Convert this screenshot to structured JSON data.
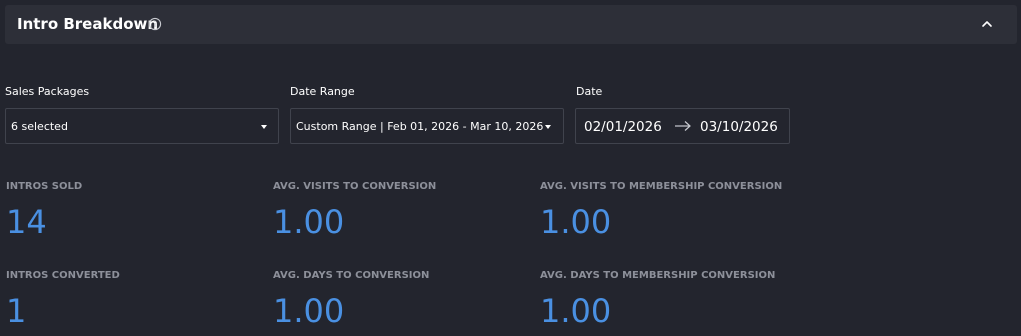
{
  "panel": {
    "title": "Intro Breakdown",
    "info_icon": "info-circle-icon",
    "collapse_icon": "chevron-up-icon"
  },
  "filters": {
    "sales_packages": {
      "label": "Sales Packages",
      "value": "6 selected"
    },
    "date_range": {
      "label": "Date Range",
      "value": "Custom Range | Feb 01, 2026 - Mar 10, 2026"
    },
    "date": {
      "label": "Date",
      "start": "02/01/2026",
      "end": "03/10/2026",
      "arrow_icon": "arrow-right-icon"
    }
  },
  "metrics": {
    "intros_sold": {
      "label": "INTROS SOLD",
      "value": "14"
    },
    "avg_visits_to_conversion": {
      "label": "AVG. VISITS TO CONVERSION",
      "value": "1.00"
    },
    "avg_visits_to_membership_conversion": {
      "label": "AVG. VISITS TO MEMBERSHIP CONVERSION",
      "value": "1.00"
    },
    "intros_converted": {
      "label": "INTROS CONVERTED",
      "value": "1"
    },
    "avg_days_to_conversion": {
      "label": "AVG. DAYS TO CONVERSION",
      "value": "1.00"
    },
    "avg_days_to_membership_conversion": {
      "label": "AVG. DAYS TO MEMBERSHIP CONVERSION",
      "value": "1.00"
    }
  },
  "colors": {
    "background": "#23252e",
    "header_background": "#2d2f38",
    "metric_value": "#4a90e2",
    "metric_label": "#8d909a",
    "border": "#40434d"
  }
}
